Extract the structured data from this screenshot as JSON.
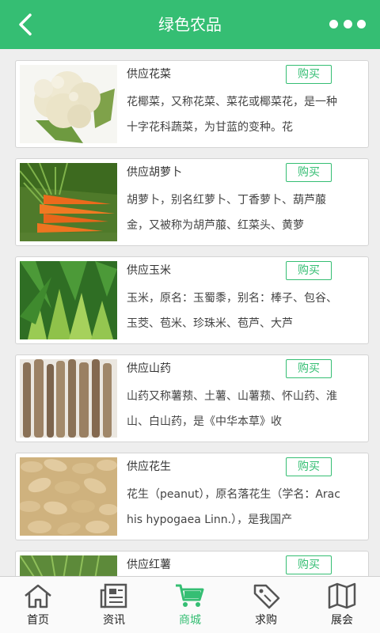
{
  "header": {
    "title": "绿色农品",
    "back_icon": "chevron-left-icon",
    "more_icon": "more-dots-icon"
  },
  "products": [
    {
      "title": "供应花菜",
      "buy_label": "购买",
      "desc": "花椰菜，又称花菜、菜花或椰菜花，是一种十字花科蔬菜，为甘蓝的变种。花"
    },
    {
      "title": "供应胡萝卜",
      "buy_label": "购买",
      "desc": "胡萝卜，别名红萝卜、丁香萝卜、葫芦菔金，又被称为胡芦菔、红菜头、黄萝"
    },
    {
      "title": "供应玉米",
      "buy_label": "购买",
      "desc": "玉米，原名：玉蜀黍，别名：棒子、包谷、玉茭、苞米、珍珠米、苞芦、大芦"
    },
    {
      "title": "供应山药",
      "buy_label": "购买",
      "desc": "山药又称薯蓣、土薯、山薯蓣、怀山药、淮山、白山药，是《中华本草》收"
    },
    {
      "title": "供应花生",
      "buy_label": "购买",
      "desc": "花生（peanut），原名落花生（学名：Arachis hypogaea Linn.），是我国产"
    },
    {
      "title": "供应红薯",
      "buy_label": "购买",
      "desc": ""
    }
  ],
  "tabbar": {
    "active_color": "#35be73",
    "items": [
      {
        "label": "首页",
        "icon": "home-icon"
      },
      {
        "label": "资讯",
        "icon": "news-icon"
      },
      {
        "label": "商城",
        "icon": "cart-icon"
      },
      {
        "label": "求购",
        "icon": "tag-icon"
      },
      {
        "label": "展会",
        "icon": "map-icon"
      }
    ]
  }
}
